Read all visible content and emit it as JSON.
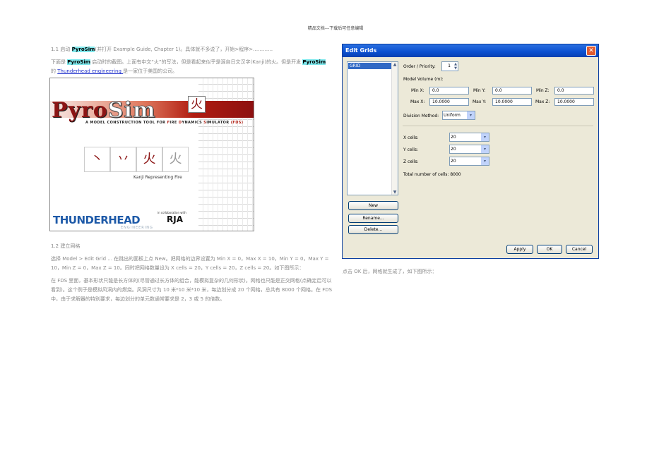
{
  "header": "精品文档---下载后可任意编辑",
  "section1": {
    "line1_prefix": "1.1 启动 ",
    "pyrosim": "PyroSim",
    "line1_suffix": "(并打开 Example Guide, Chapter 1)。具体就不多说了，开始>程序>…………",
    "line2_prefix": "下面是 ",
    "line2_mid": " 启动时的截图。上面有中文“火”的写法，但是看起来似乎是源自日文汉字(Kanji)的火。但是开发 ",
    "line3_prefix": "的 ",
    "link": "Thunderhead engineering ",
    "line3_suffix": "是一家位于美国的公司。"
  },
  "splash": {
    "logo_a": "Pyro",
    "logo_b": "Sim",
    "kanji": "火",
    "tagline_a": "A MODEL CONSTRUCTION TOOL FOR ",
    "f": "F",
    "ire": "IRE ",
    "d": "D",
    "ynamics": "YNAMICS ",
    "s": "S",
    "imulator": "IMULATOR ",
    "fds": "(FDS)",
    "stroke_steps": [
      "丶",
      "丷",
      "火",
      "火"
    ],
    "kanji_label": "Kanji Representing Fire",
    "company": "THUNDERHEAD",
    "engineering": "ENGINEERING",
    "collab": "in collaboration with",
    "rja": "RJA"
  },
  "section2": {
    "heading": "1.2 建立网格",
    "para1": "选择 Model > Edit Grid ... 在跳出的面板上点 New。把网格的边界设置为 Min X = 0，Max X = 10，Min Y = 0，Max Y = 10，Min Z = 0，Max Z = 10。同时把网格数量设为 X cells = 20，Y cells = 20，Z cells = 20。如下图所示：",
    "para2": "在 FDS 里面，基本形状只能是长方体的(尽管通过长方体的组合，能模拟复杂的几何形状)。网格也只能是正交网格(点确定后可以看到)。这个例子是模拟风洞内的燃烧。风洞尺寸为 10 米*10 米*10 米，每边划分成 20 个网格，总共有 8000 个网格。在 FDS 中，由于求解器的特别要求，每边划分的单元数通常要求是 2，3 或 5 的倍数。"
  },
  "dialog": {
    "title": "Edit Grids",
    "close": "✕",
    "grid_list": [
      "GRID"
    ],
    "order_label": "Order / Priority:",
    "order_value": "1",
    "model_volume": "Model Volume (m):",
    "min_x_label": "Min X:",
    "min_x": "0.0",
    "min_y_label": "Min Y:",
    "min_y": "0.0",
    "min_z_label": "Min Z:",
    "min_z": "0.0",
    "max_x_label": "Max X:",
    "max_x": "10.0000",
    "max_y_label": "Max Y:",
    "max_y": "10.0000",
    "max_z_label": "Max Z:",
    "max_z": "10.0000",
    "division_label": "Division Method:",
    "division_value": "Uniform",
    "x_cells_label": "X cells:",
    "x_cells": "20",
    "y_cells_label": "Y cells:",
    "y_cells": "20",
    "z_cells_label": "Z cells:",
    "z_cells": "20",
    "total_label": "Total number of cells:",
    "total": "8000",
    "new": "New",
    "rename": "Rename...",
    "delete": "Delete...",
    "apply": "Apply",
    "ok": "OK",
    "cancel": "Cancel"
  },
  "caption": "点击 OK 后，网格就生成了，如下图所示："
}
